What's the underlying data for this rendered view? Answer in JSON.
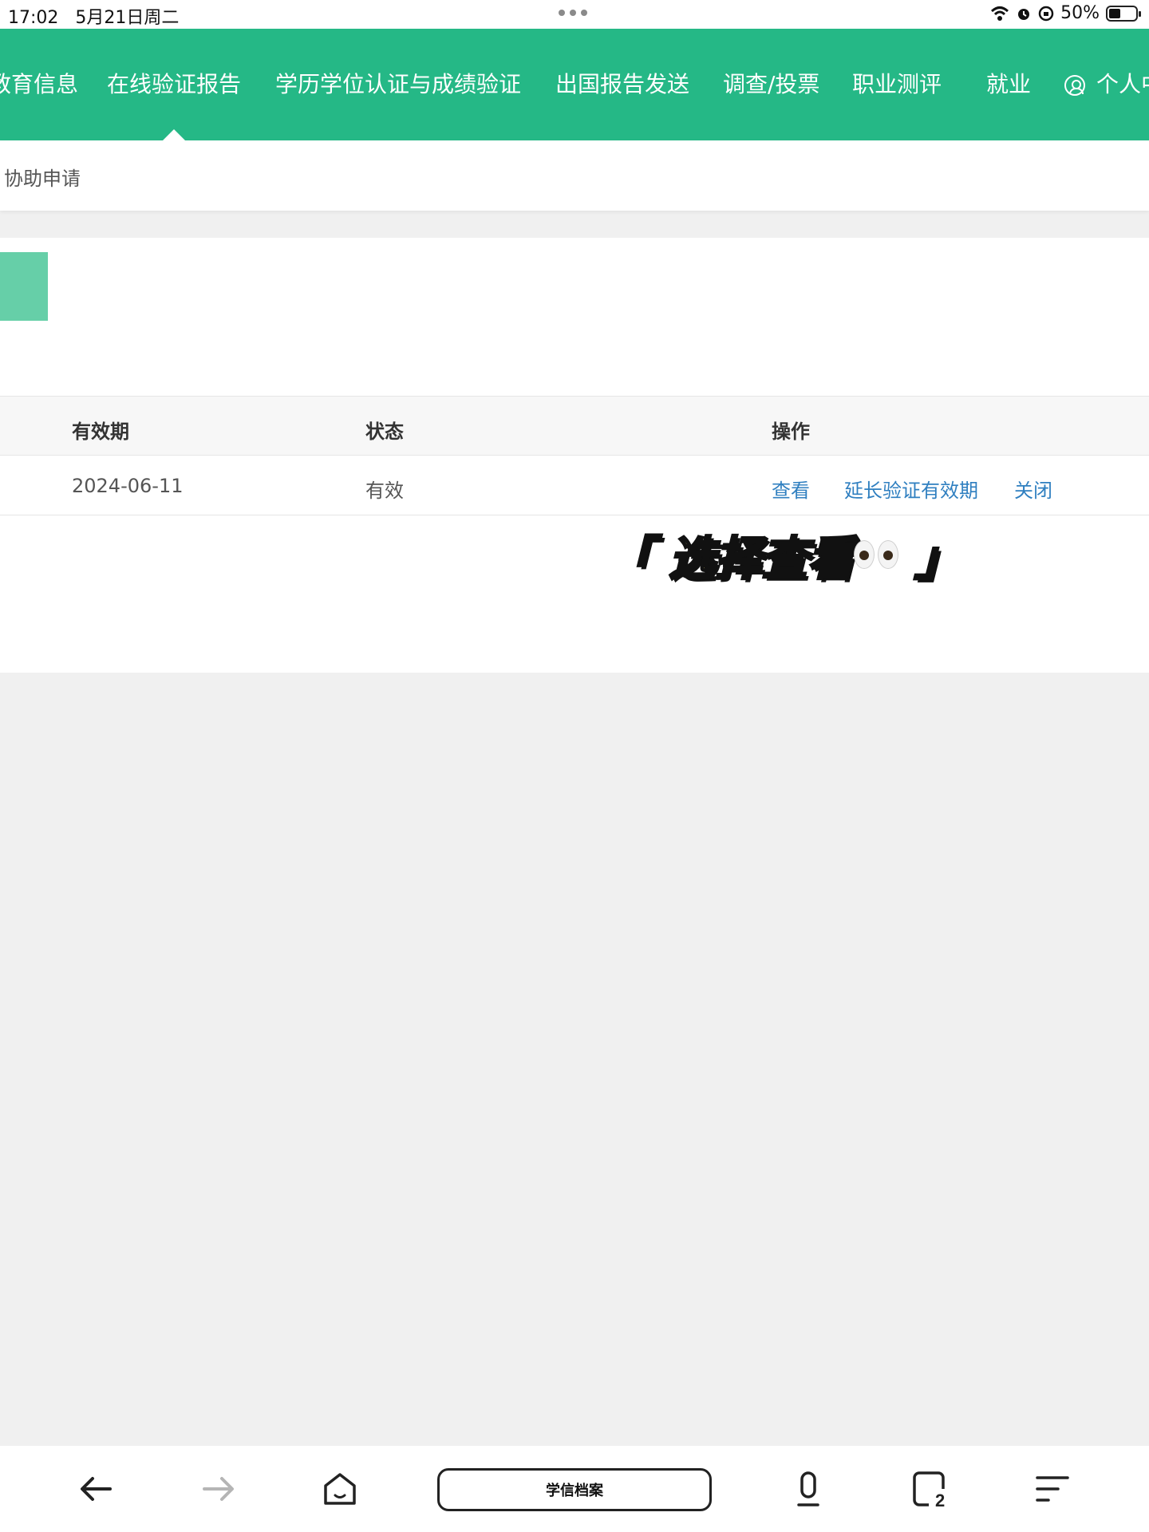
{
  "status_bar": {
    "time": "17:02",
    "date": "5月21日周二",
    "battery": "50%"
  },
  "nav": {
    "items": [
      "教育信息",
      "在线验证报告",
      "学历学位认证与成绩验证",
      "出国报告发送",
      "调查/投票",
      "职业测评",
      "就业"
    ],
    "user_center": "个人中心",
    "active_index": 1,
    "color": "#25b886"
  },
  "subbar": {
    "link": "协助申请"
  },
  "table": {
    "headers": [
      "有效期",
      "状态",
      "操作"
    ],
    "rows": [
      {
        "expiry": "2024-06-11",
        "status": "有效",
        "actions": [
          "查看",
          "延长验证有效期",
          "关闭"
        ]
      }
    ]
  },
  "overlay": {
    "text": "「 选择查看",
    "close_bracket": "」",
    "emoji": "eyes"
  },
  "bottom_bar": {
    "address": "学信档案",
    "tab_count": "2"
  },
  "colors": {
    "link": "#2f7fc0",
    "accent_light": "#66cfa8"
  }
}
